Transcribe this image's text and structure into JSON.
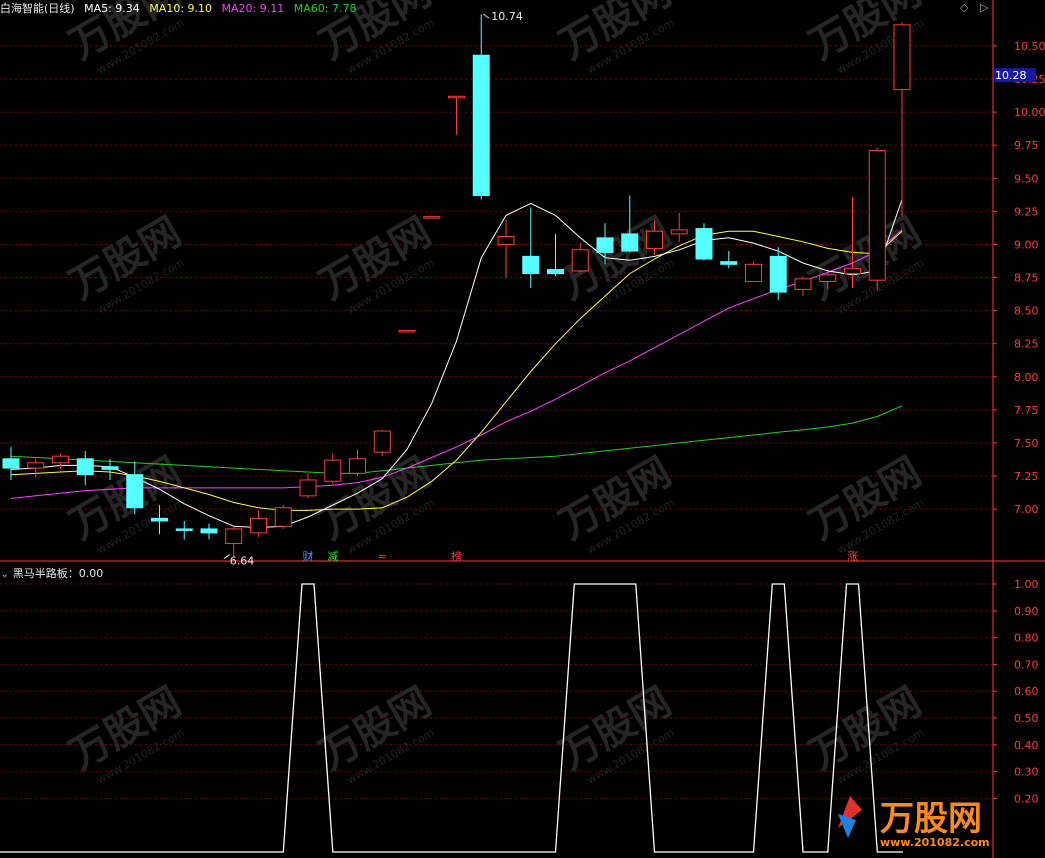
{
  "header": {
    "title": "白海智能(日线)",
    "ma5": "MA5: 9.34",
    "ma10": "MA10: 9.10",
    "ma20": "MA20: 9.11",
    "ma60": "MA60: 7.78"
  },
  "indicator": {
    "label": "黑马半路板：0.00"
  },
  "watermark": {
    "brand": "万股网",
    "url": "www.201082.com"
  },
  "colors": {
    "up": "#ff3b3b",
    "down": "#54ffff",
    "ma5": "#ffffff",
    "ma10": "#ffff40",
    "ma20": "#ff40ff",
    "ma60": "#20d020",
    "grid": "#8a0000",
    "axis": "#ff3b3b",
    "price_tag_bg": "#1a1aa0"
  },
  "chart_data": [
    {
      "type": "candlestick",
      "title": "白海智能(日线)",
      "y_ticks": [
        "10.50",
        "10.25",
        "10.00",
        "9.75",
        "9.50",
        "9.25",
        "9.00",
        "8.75",
        "8.50",
        "8.25",
        "8.00",
        "7.75",
        "7.50",
        "7.25",
        "7.00"
      ],
      "ylim": [
        6.5,
        10.78
      ],
      "current_price": "10.28",
      "annotations": {
        "high": "10.74",
        "low": "6.64"
      },
      "event_markers": [
        {
          "text": "财",
          "index": 12,
          "color": "#4a8cff"
        },
        {
          "text": "减",
          "index": 13,
          "color": "#30e030"
        },
        {
          "text": "≈",
          "index": 15,
          "color": "#ff4040"
        },
        {
          "text": "榜",
          "index": 18,
          "color": "#ff4040"
        },
        {
          "text": "涨",
          "index": 34,
          "color": "#ff4040"
        }
      ],
      "candles": [
        {
          "o": 7.38,
          "h": 7.47,
          "l": 7.22,
          "c": 7.31
        },
        {
          "o": 7.31,
          "h": 7.38,
          "l": 7.24,
          "c": 7.35
        },
        {
          "o": 7.35,
          "h": 7.42,
          "l": 7.3,
          "c": 7.4
        },
        {
          "o": 7.38,
          "h": 7.44,
          "l": 7.18,
          "c": 7.26
        },
        {
          "o": 7.32,
          "h": 7.38,
          "l": 7.22,
          "c": 7.3
        },
        {
          "o": 7.26,
          "h": 7.36,
          "l": 6.96,
          "c": 7.01
        },
        {
          "o": 6.93,
          "h": 7.03,
          "l": 6.81,
          "c": 6.91
        },
        {
          "o": 6.85,
          "h": 6.91,
          "l": 6.77,
          "c": 6.84
        },
        {
          "o": 6.85,
          "h": 6.89,
          "l": 6.77,
          "c": 6.82
        },
        {
          "o": 6.74,
          "h": 6.87,
          "l": 6.64,
          "c": 6.85
        },
        {
          "o": 6.82,
          "h": 6.99,
          "l": 6.79,
          "c": 6.93
        },
        {
          "o": 6.87,
          "h": 7.03,
          "l": 6.85,
          "c": 7.01
        },
        {
          "o": 7.1,
          "h": 7.27,
          "l": 7.08,
          "c": 7.22
        },
        {
          "o": 7.21,
          "h": 7.42,
          "l": 7.19,
          "c": 7.37
        },
        {
          "o": 7.27,
          "h": 7.45,
          "l": 7.25,
          "c": 7.38
        },
        {
          "o": 7.43,
          "h": 7.6,
          "l": 7.4,
          "c": 7.59
        },
        {
          "o": 8.35,
          "h": 8.35,
          "l": 8.35,
          "c": 8.35
        },
        {
          "o": 9.21,
          "h": 9.21,
          "l": 9.21,
          "c": 9.21
        },
        {
          "o": 10.12,
          "h": 10.12,
          "l": 9.83,
          "c": 10.12
        },
        {
          "o": 10.43,
          "h": 10.74,
          "l": 9.34,
          "c": 9.37
        },
        {
          "o": 9.0,
          "h": 9.19,
          "l": 8.75,
          "c": 9.06
        },
        {
          "o": 8.91,
          "h": 9.28,
          "l": 8.67,
          "c": 8.78
        },
        {
          "o": 8.81,
          "h": 9.08,
          "l": 8.76,
          "c": 8.78
        },
        {
          "o": 8.8,
          "h": 9.01,
          "l": 8.79,
          "c": 8.96
        },
        {
          "o": 9.05,
          "h": 9.16,
          "l": 8.85,
          "c": 8.94
        },
        {
          "o": 9.08,
          "h": 9.37,
          "l": 8.94,
          "c": 8.95
        },
        {
          "o": 8.97,
          "h": 9.18,
          "l": 8.92,
          "c": 9.1
        },
        {
          "o": 9.08,
          "h": 9.24,
          "l": 9.02,
          "c": 9.11
        },
        {
          "o": 9.12,
          "h": 9.16,
          "l": 8.88,
          "c": 8.89
        },
        {
          "o": 8.87,
          "h": 8.95,
          "l": 8.82,
          "c": 8.85
        },
        {
          "o": 8.72,
          "h": 8.87,
          "l": 8.73,
          "c": 8.85
        },
        {
          "o": 8.91,
          "h": 8.98,
          "l": 8.58,
          "c": 8.64
        },
        {
          "o": 8.66,
          "h": 8.76,
          "l": 8.61,
          "c": 8.74
        },
        {
          "o": 8.72,
          "h": 8.79,
          "l": 8.66,
          "c": 8.77
        },
        {
          "o": 8.78,
          "h": 9.36,
          "l": 8.67,
          "c": 8.82
        },
        {
          "o": 8.73,
          "h": 9.73,
          "l": 8.65,
          "c": 9.71
        },
        {
          "o": 10.17,
          "h": 10.68,
          "l": 9.21,
          "c": 10.66
        }
      ],
      "ma5": [
        7.3,
        7.31,
        7.33,
        7.33,
        7.32,
        7.24,
        7.15,
        7.04,
        6.95,
        6.87,
        6.86,
        6.87,
        6.94,
        7.03,
        7.12,
        7.23,
        7.45,
        7.8,
        8.27,
        8.9,
        9.22,
        9.31,
        9.22,
        9.05,
        8.9,
        8.88,
        8.91,
        8.96,
        9.03,
        9.05,
        9.01,
        8.95,
        8.86,
        8.8,
        8.77,
        8.8,
        9.34
      ],
      "ma10": [
        7.26,
        7.27,
        7.28,
        7.29,
        7.28,
        7.25,
        7.21,
        7.16,
        7.11,
        7.05,
        7.01,
        6.99,
        6.99,
        7.0,
        7.0,
        7.01,
        7.09,
        7.21,
        7.37,
        7.58,
        7.81,
        8.04,
        8.25,
        8.44,
        8.61,
        8.78,
        8.89,
        8.99,
        9.07,
        9.1,
        9.1,
        9.06,
        9.02,
        8.97,
        8.94,
        8.93,
        9.1
      ],
      "ma20": [
        7.08,
        7.1,
        7.12,
        7.14,
        7.15,
        7.16,
        7.16,
        7.16,
        7.16,
        7.16,
        7.16,
        7.16,
        7.17,
        7.18,
        7.2,
        7.24,
        7.31,
        7.39,
        7.47,
        7.56,
        7.66,
        7.74,
        7.83,
        7.93,
        8.03,
        8.12,
        8.22,
        8.32,
        8.42,
        8.52,
        8.59,
        8.66,
        8.72,
        8.79,
        8.86,
        8.95,
        9.11
      ],
      "ma60": [
        7.4,
        7.39,
        7.38,
        7.37,
        7.36,
        7.35,
        7.34,
        7.33,
        7.32,
        7.31,
        7.3,
        7.29,
        7.28,
        7.27,
        7.27,
        7.29,
        7.31,
        7.33,
        7.35,
        7.37,
        7.38,
        7.39,
        7.4,
        7.42,
        7.44,
        7.46,
        7.48,
        7.5,
        7.52,
        7.54,
        7.56,
        7.58,
        7.6,
        7.62,
        7.65,
        7.7,
        7.78
      ]
    },
    {
      "type": "line",
      "title": "黑马半路板",
      "y_ticks": [
        "1.00",
        "0.90",
        "0.80",
        "0.70",
        "0.60",
        "0.50",
        "0.40",
        "0.30",
        "0.20"
      ],
      "ylim": [
        -0.02,
        1.05
      ],
      "values": [
        0,
        0,
        0,
        0,
        0,
        0,
        0,
        0,
        0,
        0,
        0,
        0,
        1,
        0,
        0,
        0,
        0,
        0,
        0,
        0,
        0,
        0,
        0,
        1,
        1,
        1,
        0,
        0,
        0,
        0,
        0,
        1,
        0,
        0,
        1,
        0,
        0
      ]
    }
  ]
}
